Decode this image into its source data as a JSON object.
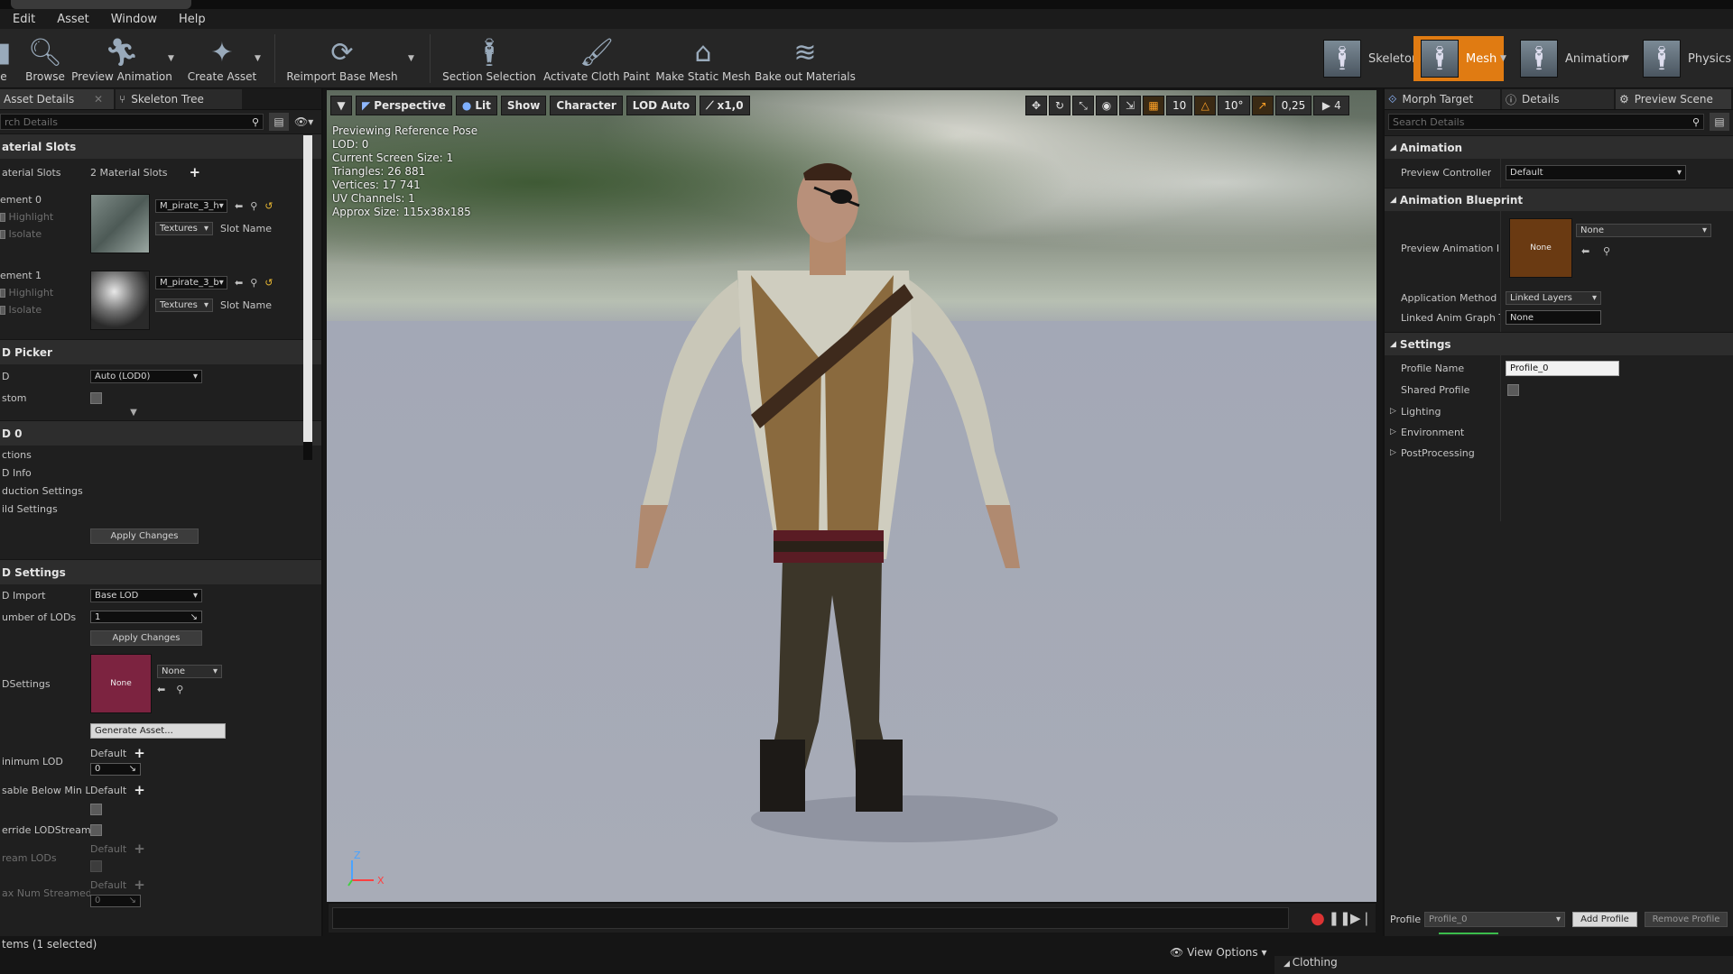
{
  "menubar": {
    "items": [
      "Edit",
      "Asset",
      "Window",
      "Help"
    ]
  },
  "toolbar": {
    "buttons": [
      {
        "label": "e",
        "icon": "save-icon"
      },
      {
        "label": "Browse",
        "icon": "browse-icon"
      },
      {
        "label": "Preview Animation",
        "icon": "preview-animation-icon"
      },
      {
        "label": "Create Asset",
        "icon": "create-asset-icon"
      },
      {
        "label": "Reimport Base Mesh",
        "icon": "reimport-icon"
      },
      {
        "label": "Section Selection",
        "icon": "section-selection-icon"
      },
      {
        "label": "Activate Cloth Paint",
        "icon": "cloth-paint-icon"
      },
      {
        "label": "Make Static Mesh",
        "icon": "static-mesh-icon"
      },
      {
        "label": "Bake out Materials",
        "icon": "bake-materials-icon"
      }
    ],
    "modes": [
      {
        "label": "Skeleton",
        "active": false
      },
      {
        "label": "Mesh",
        "active": true
      },
      {
        "label": "Animation",
        "active": false
      },
      {
        "label": "Physics",
        "active": false
      }
    ],
    "accent": "#e07b12"
  },
  "left_panel": {
    "tabs": [
      "Asset Details",
      "Skeleton Tree"
    ],
    "search_placeholder": "rch Details",
    "material_slots": {
      "header": "aterial Slots",
      "row_label": "aterial Slots",
      "count_text": "2 Material Slots",
      "elements": [
        {
          "label": "ement 0",
          "highlight": "Highlight",
          "isolate": "Isolate",
          "material": "M_pirate_3_h",
          "textures": "Textures",
          "slot_name": "Slot Name"
        },
        {
          "label": "ement 1",
          "highlight": "Highlight",
          "isolate": "Isolate",
          "material": "M_pirate_3_b",
          "textures": "Textures",
          "slot_name": "Slot Name"
        }
      ]
    },
    "lod_picker": {
      "header": "D Picker",
      "lod_label": "D",
      "lod_value": "Auto (LOD0)",
      "custom_label": "stom"
    },
    "lod0": {
      "header": "D 0",
      "items": [
        "ctions",
        "D Info",
        "duction Settings",
        "ild Settings"
      ],
      "apply_changes": "Apply Changes"
    },
    "lod_settings": {
      "header": "D Settings",
      "lod_import_label": "D Import",
      "lod_import_value": "Base LOD",
      "num_lods_label": "umber of LODs",
      "num_lods_value": "1",
      "apply_changes": "Apply Changes",
      "lodsettings_label": "DSettings",
      "none_thumb": "None",
      "none_dropdown": "None",
      "generate_asset": "Generate Asset...",
      "minimum_lod_label": "inimum LOD",
      "default_text": "Default",
      "minimum_lod_value": "0",
      "disable_below_label": "sable Below Min Lo",
      "override_label": "erride LODStreami",
      "stream_lods_label": "ream LODs",
      "max_num_label": "ax Num Streamed I",
      "max_num_value": "0"
    },
    "status": "tems (1 selected)"
  },
  "viewport": {
    "toolbar": {
      "perspective": "Perspective",
      "lit": "Lit",
      "show": "Show",
      "character": "Character",
      "lod_auto": "LOD Auto",
      "speed": "x1,0",
      "grid_value": "10",
      "angle_value": "10°",
      "scale_value": "0,25",
      "camera_speed": "4"
    },
    "stats": [
      "Previewing Reference Pose",
      "LOD: 0",
      "Current Screen Size: 1",
      "Triangles: 26 881",
      "Vertices: 17 741",
      "UV Channels: 1",
      "Approx Size: 115x38x185"
    ],
    "axis": {
      "z": "Z",
      "x": "X"
    },
    "view_options": "View Options"
  },
  "right_panel": {
    "tabs": [
      "Morph Target",
      "Details",
      "Preview Scene"
    ],
    "search_placeholder": "Search Details",
    "animation": {
      "header": "Animation",
      "preview_controller_label": "Preview Controller",
      "preview_controller_value": "Default"
    },
    "animation_blueprint": {
      "header": "Animation Blueprint",
      "preview_anim_label": "Preview Animation Bl",
      "thumb_text": "None",
      "dropdown_value": "None",
      "application_method_label": "Application Method",
      "application_method_value": "Linked Layers",
      "linked_anim_label": "Linked Anim Graph Ta",
      "linked_anim_value": "None"
    },
    "settings": {
      "header": "Settings",
      "profile_name_label": "Profile Name",
      "profile_name_value": "Profile_0",
      "shared_profile_label": "Shared Profile",
      "collapsed": [
        "Lighting",
        "Environment",
        "PostProcessing"
      ]
    },
    "footer": {
      "profile_label": "Profile",
      "profile_value": "Profile_0",
      "add_profile": "Add Profile",
      "remove_profile": "Remove Profile",
      "clothing": "Clothing"
    }
  }
}
